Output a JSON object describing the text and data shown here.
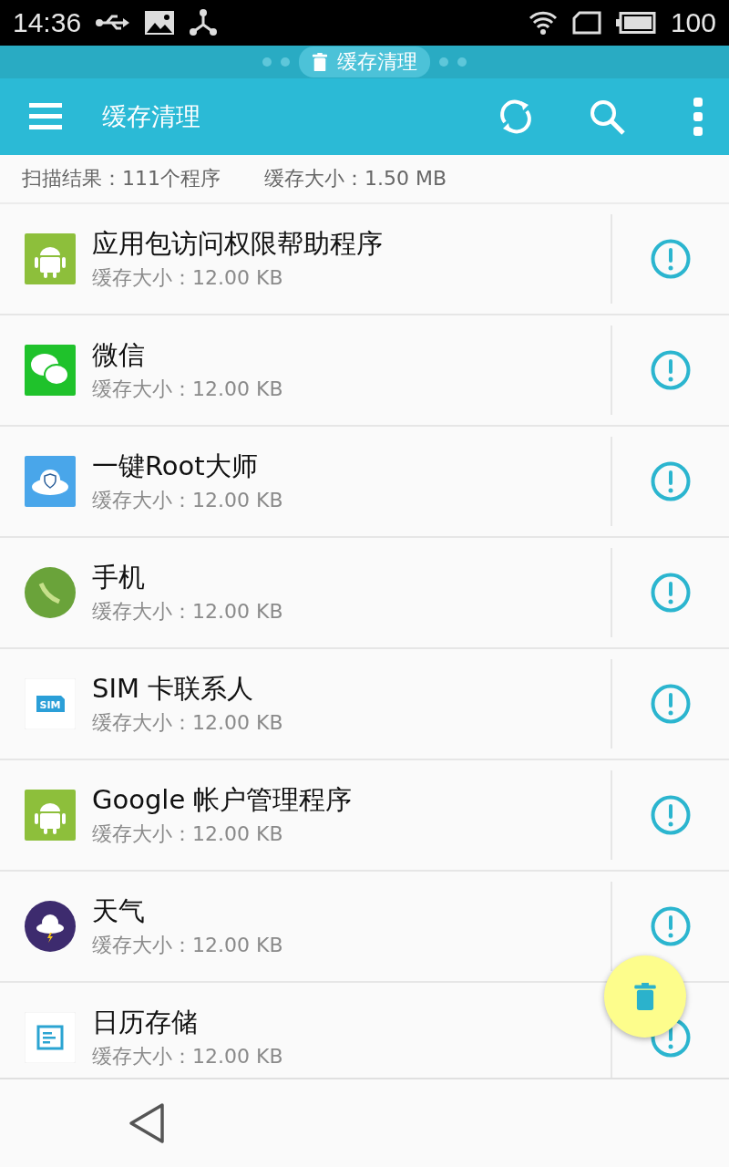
{
  "status_bar": {
    "time": "14:36",
    "battery": "100"
  },
  "notification_pill": {
    "label": "缓存清理"
  },
  "app_bar": {
    "title": "缓存清理"
  },
  "summary": {
    "scan_result": "扫描结果：111个程序",
    "cache_total": "缓存大小：1.50 MB"
  },
  "apps": [
    {
      "kind": "android",
      "name": "应用包访问权限帮助程序",
      "size": "缓存大小：12.00 KB"
    },
    {
      "kind": "chat",
      "name": "微信",
      "size": "缓存大小：12.00 KB"
    },
    {
      "kind": "cloud",
      "name": "一键Root大师",
      "size": "缓存大小：12.00 KB"
    },
    {
      "kind": "circle",
      "name": "手机",
      "size": "缓存大小：12.00 KB"
    },
    {
      "kind": "sim",
      "name": "SIM 卡联系人",
      "size": "缓存大小：12.00 KB",
      "badge": "SIM"
    },
    {
      "kind": "android",
      "name": "Google 帐户管理程序",
      "size": "缓存大小：12.00 KB"
    },
    {
      "kind": "weather",
      "name": "天气",
      "size": "缓存大小：12.00 KB"
    },
    {
      "kind": "document",
      "name": "日历存储",
      "size": "缓存大小：12.00 KB"
    }
  ]
}
